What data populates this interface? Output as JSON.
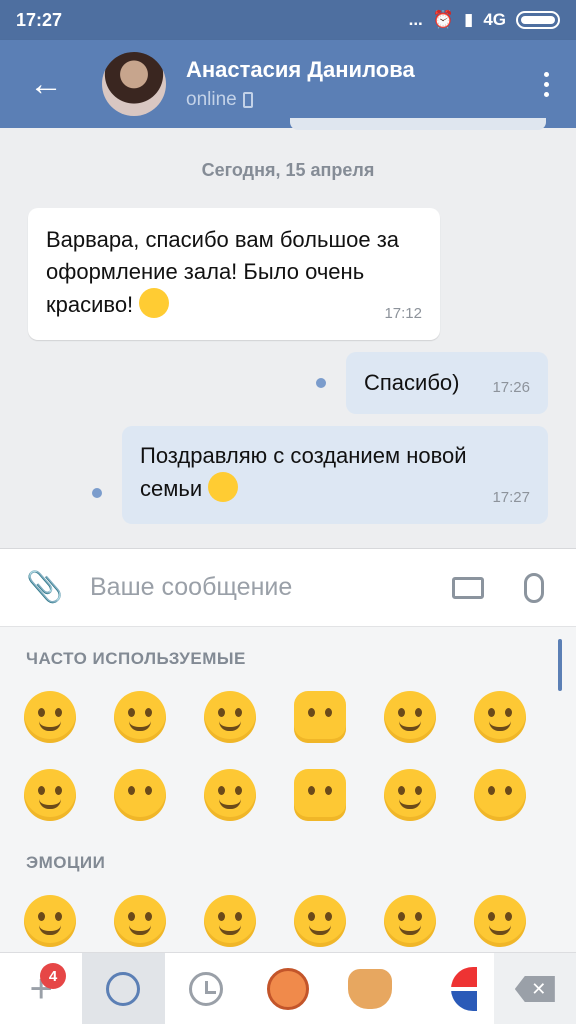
{
  "status_bar": {
    "time": "17:27",
    "dots": "...",
    "network": "4G"
  },
  "header": {
    "back_icon": "arrow-left-icon",
    "name": "Анастасия Данилова",
    "status": "online",
    "status_icon": "mobile-phone-icon",
    "menu_icon": "more-vertical-icon",
    "colors": {
      "bar": "#5b7fb5",
      "status_bar": "#4e6fa0"
    }
  },
  "chat": {
    "date": "Сегодня, 15 апреля",
    "messages": [
      {
        "direction": "in",
        "text": "Варвара, спасибо вам большое за оформление зала! Было очень красиво!",
        "emoji": "smiling-face-emoji",
        "time": "17:12"
      },
      {
        "direction": "out",
        "text": "Спасибо)",
        "time": "17:26"
      },
      {
        "direction": "out",
        "text": "Поздравляю с созданием новой семьи",
        "emoji": "kissing-face-heart-emoji",
        "time": "17:27"
      }
    ]
  },
  "input": {
    "placeholder": "Ваше сообщение",
    "attach_icon": "paperclip-icon",
    "keyboard_icon": "keyboard-icon",
    "mic_icon": "microphone-icon"
  },
  "emoji_panel": {
    "sections": [
      {
        "title": "ЧАСТО ИСПОЛЬЗУЕМЫЕ",
        "rows": [
          [
            "rofl",
            "grinning-squint",
            "kiss-heart",
            "thumbs-up",
            "wink",
            "crying"
          ],
          [
            "smile-blush",
            "kissing",
            "heart-eyes",
            "clapping-hands",
            "pensive",
            "kissing-smiling-eyes"
          ]
        ]
      },
      {
        "title": "ЭМОЦИИ",
        "rows": [
          [
            "grin",
            "beaming",
            "smile-blush",
            "smiley",
            "rofl",
            "grinning-squint"
          ]
        ]
      }
    ]
  },
  "bottom_bar": {
    "badge_count": "4",
    "delete_symbol": "✕",
    "tabs": [
      "add-icon",
      "emoji-icon",
      "recent-clock-icon",
      "sticker-pack-redhead",
      "sticker-pack-corgi",
      "sticker-pack-pepsi",
      "backspace-icon"
    ],
    "accent": "#5b7fb5",
    "badge_color": "#e64646"
  }
}
